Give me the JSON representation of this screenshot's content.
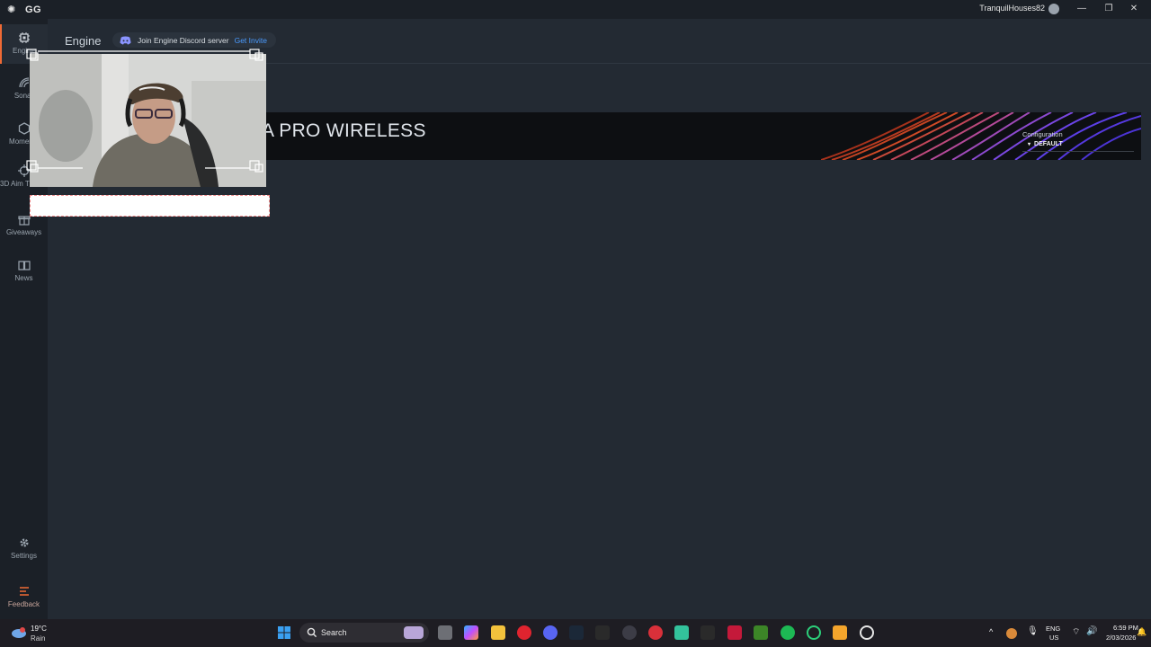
{
  "titlebar": {
    "app_name": "GG",
    "username": "TranquilHouses82"
  },
  "sidebar": {
    "items": [
      {
        "label": "Engine",
        "icon": "chip-icon",
        "active": true
      },
      {
        "label": "Sonar",
        "icon": "sonar-icon"
      },
      {
        "label": "Moments",
        "icon": "moments-icon"
      },
      {
        "label": "3D Aim Trainer",
        "icon": "aim-icon"
      },
      {
        "label": "Giveaways",
        "icon": "gift-icon"
      },
      {
        "label": "News",
        "icon": "news-icon"
      }
    ],
    "bottom": [
      {
        "label": "Settings",
        "icon": "gear-icon"
      },
      {
        "label": "Feedback",
        "icon": "feedback-icon"
      }
    ]
  },
  "main": {
    "title": "Engine",
    "discord": {
      "text": "Join Engine Discord server",
      "link": "Get Invite"
    },
    "device": {
      "visible_name": "A PRO WIRELESS",
      "config_label": "Configuration",
      "config_value": "DEFAULT"
    }
  },
  "taskbar": {
    "weather": {
      "temp": "19°C",
      "cond": "Rain"
    },
    "search_label": "Search",
    "lang_top": "ENG",
    "lang_bottom": "US",
    "time": "6:59 PM",
    "date": "2/03/2026"
  },
  "colors": {
    "accent": "#f06a35",
    "link": "#4a9bff",
    "bg": "#232a33",
    "sidebar": "#1b2027"
  }
}
